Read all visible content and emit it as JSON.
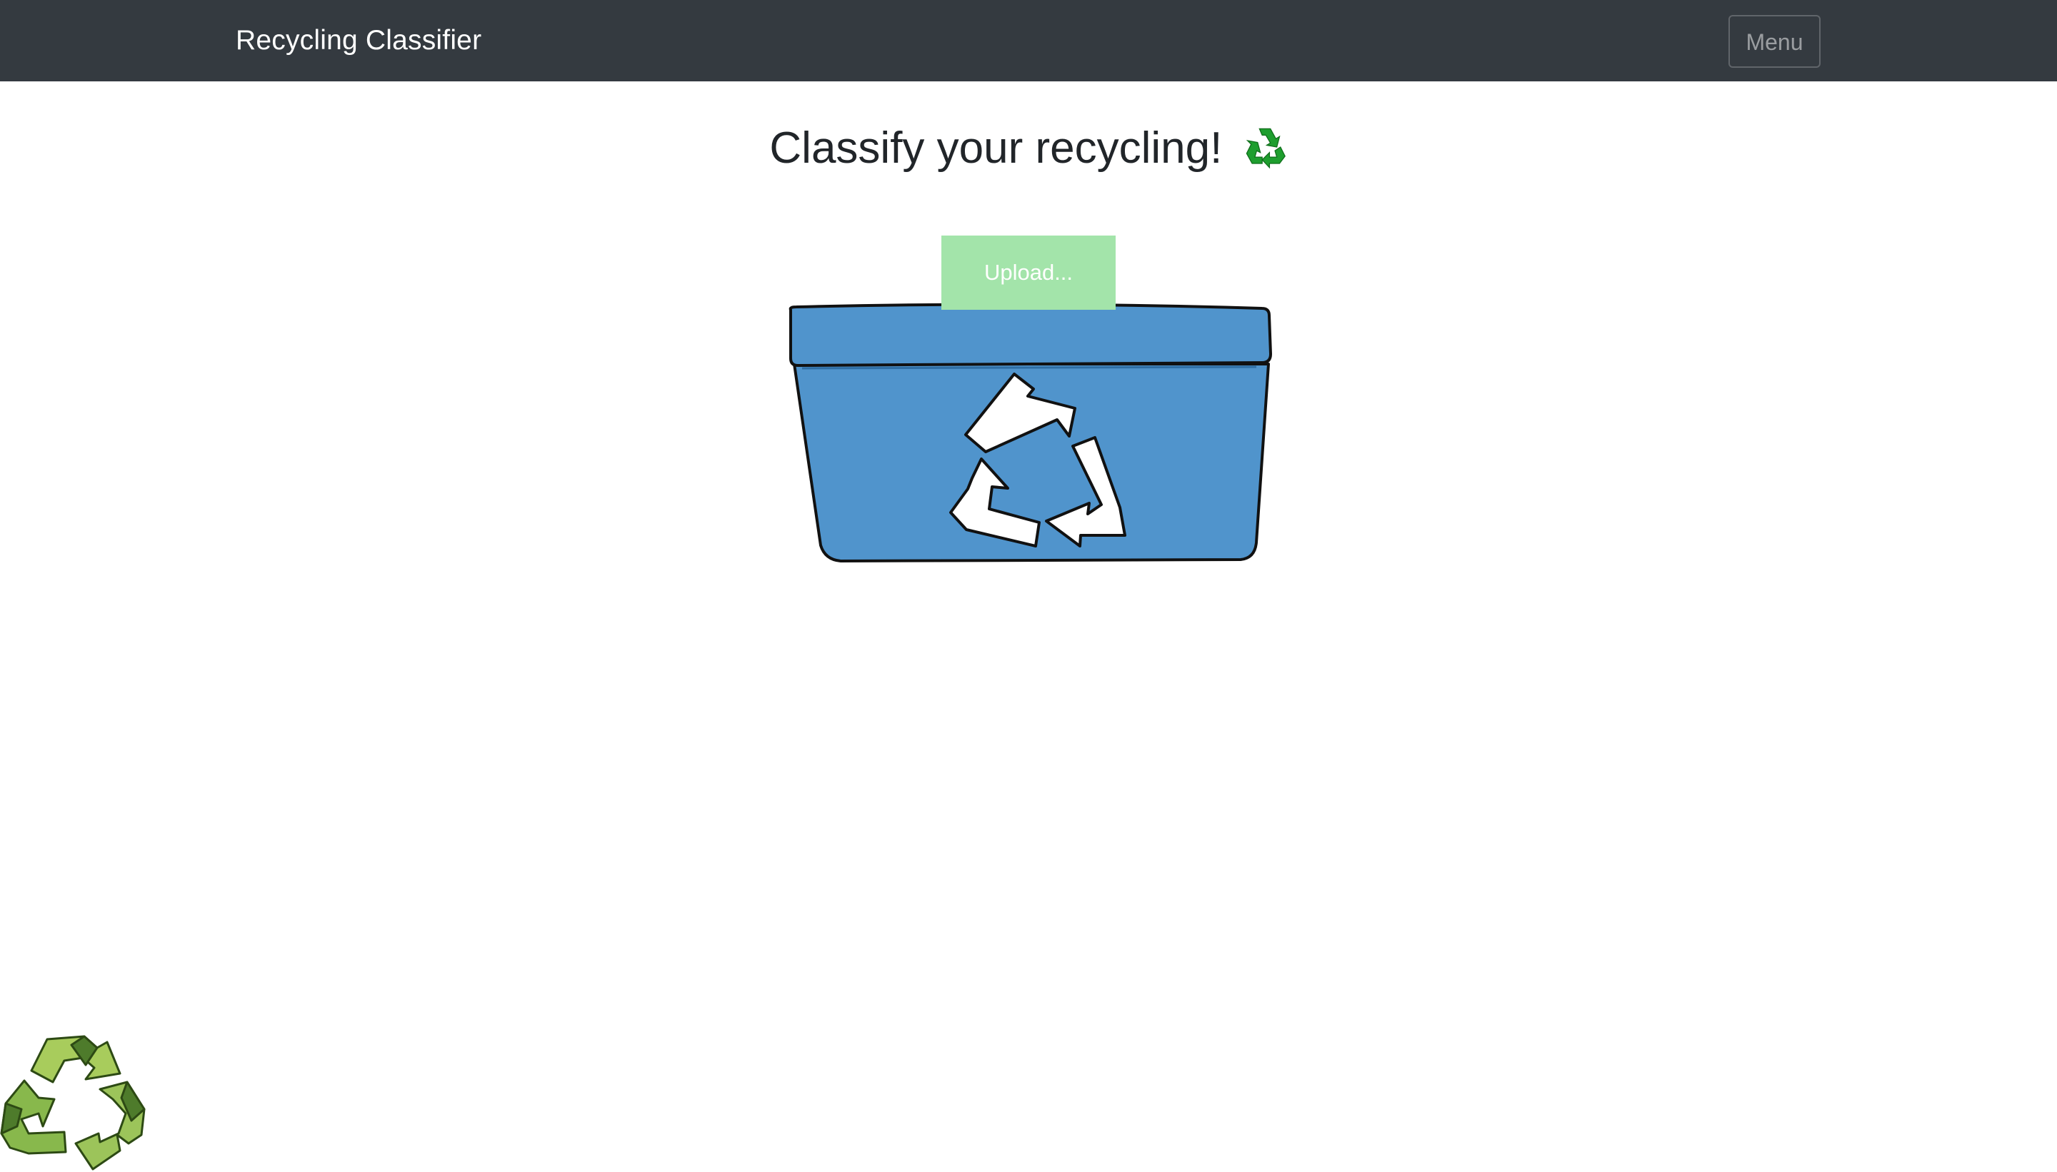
{
  "navbar": {
    "brand": "Recycling Classifier",
    "menu_label": "Menu"
  },
  "main": {
    "heading": "Classify your recycling!",
    "heading_emoji": "recycling-symbol-icon",
    "upload_label": "Upload..."
  },
  "colors": {
    "navbar_bg": "#343a40",
    "upload_bg": "#a3e4aa",
    "bin_blue": "#5094cc",
    "emoji_green": "#1e9e2e",
    "logo_green": "#9cc45a"
  }
}
